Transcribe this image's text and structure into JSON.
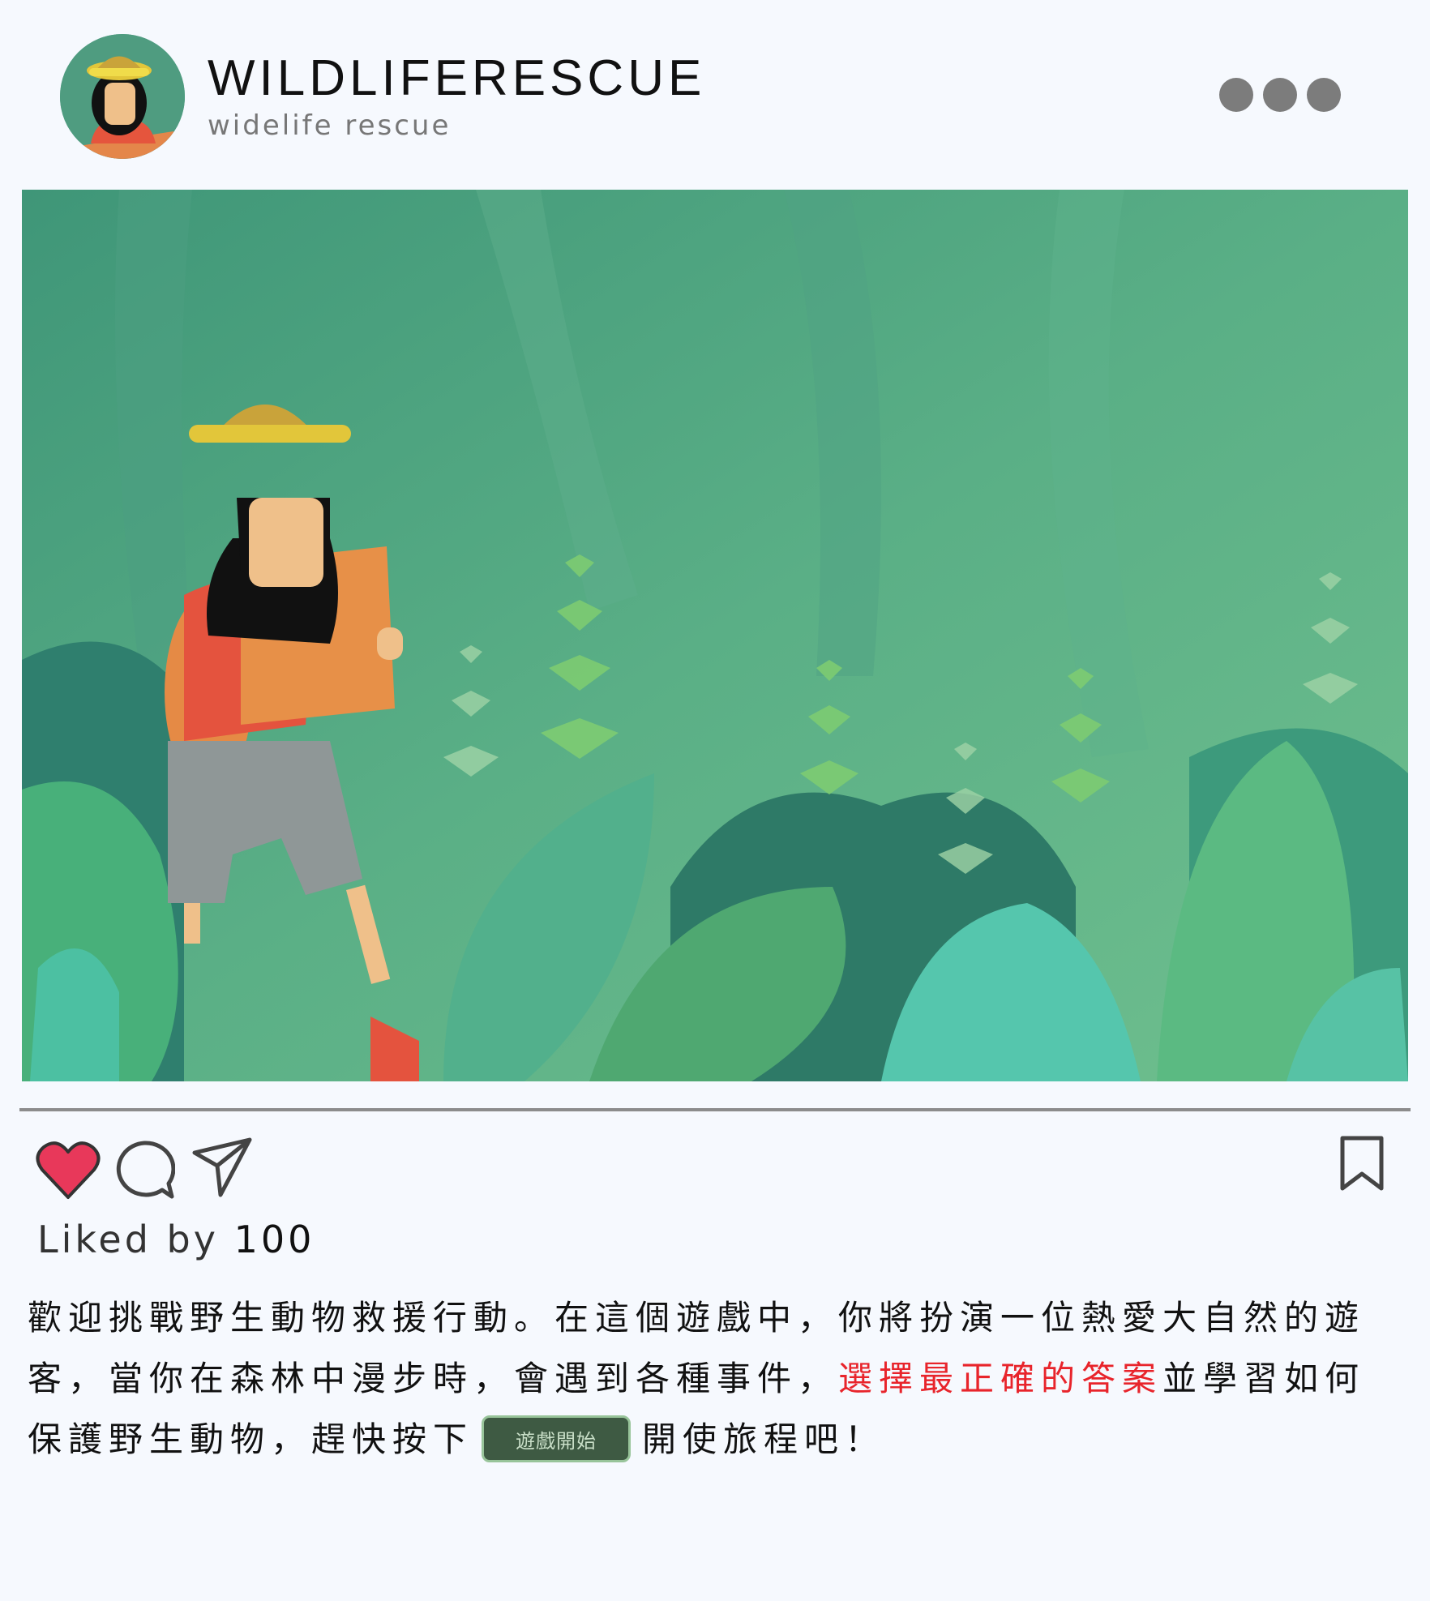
{
  "header": {
    "username": "WILDLIFERESCUE",
    "subname": "widelife rescue",
    "more_icon": "more-dots-icon"
  },
  "actions": {
    "like_icon": "heart-icon",
    "like_color": "#e8385a",
    "comment_icon": "comment-icon",
    "share_icon": "send-icon",
    "bookmark_icon": "bookmark-icon"
  },
  "likes": {
    "label": "Liked by ",
    "count": "100"
  },
  "caption": {
    "part1": "歡迎挑戰野生動物救援行動。在這個遊戲中，你將扮演一位熱愛大自然的遊客，當你在森林中漫步時，會遇到各種事件，",
    "highlight": "選擇最正確的答案",
    "part2": "並學習如何保護野生動物，趕快按下",
    "start_button": "遊戲開始",
    "part3": "開使旅程吧！",
    "highlight_color": "#e8242b"
  }
}
